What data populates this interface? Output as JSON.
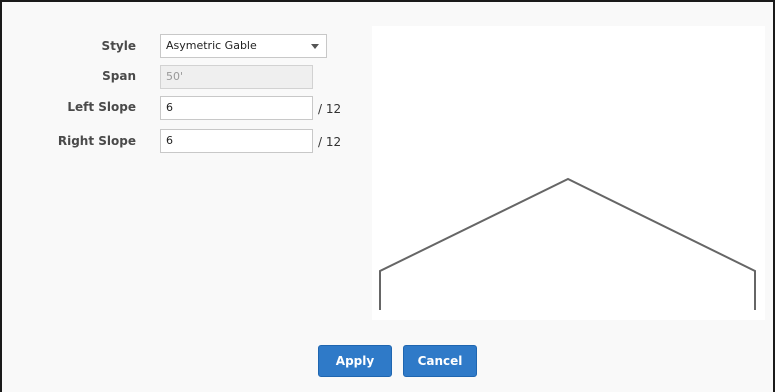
{
  "form": {
    "style_label": "Style",
    "style_value": "Asymetric Gable",
    "span_label": "Span",
    "span_value": "50'",
    "left_slope_label": "Left Slope",
    "left_slope_value": "6",
    "left_slope_per": "/ 12",
    "right_slope_label": "Right Slope",
    "right_slope_value": "6",
    "right_slope_per": "/ 12"
  },
  "buttons": {
    "apply": "Apply",
    "cancel": "Cancel"
  },
  "colors": {
    "button_blue": "#2f7ac8",
    "roof_line": "#666666"
  }
}
